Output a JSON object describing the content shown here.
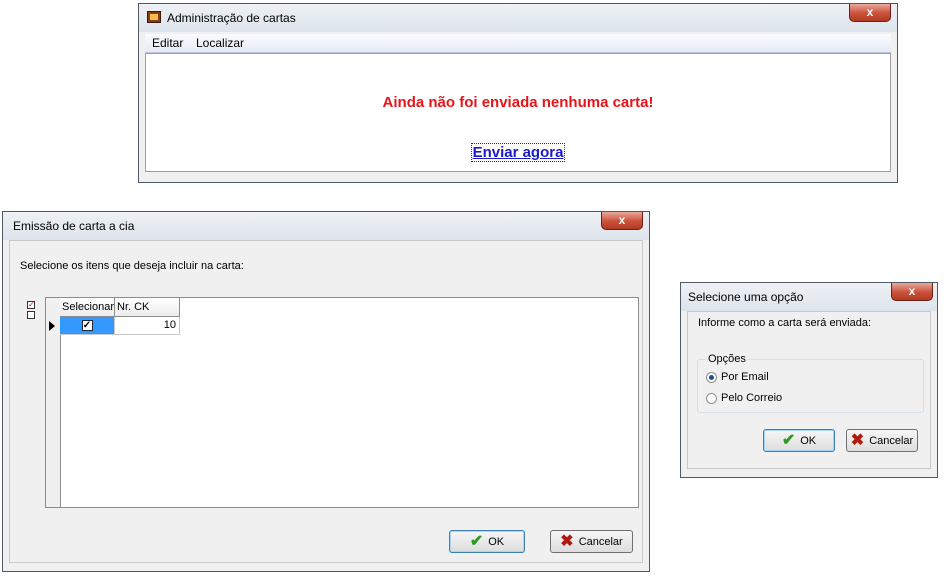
{
  "window_main": {
    "title": "Administração de cartas",
    "close_label": "x",
    "menu": [
      "Editar",
      "Localizar"
    ],
    "message": "Ainda não foi enviada nenhuma carta!",
    "link_label": "Enviar agora"
  },
  "window_emissao": {
    "title": "Emissão de carta a cia",
    "close_label": "x",
    "prompt": "Selecione os itens que deseja incluir na carta:",
    "grid": {
      "columns": [
        "Selecionar",
        "Nr. CK"
      ],
      "rows": [
        {
          "selected": true,
          "nr_ck": "10"
        }
      ]
    },
    "ok_label": "OK",
    "cancel_label": "Cancelar"
  },
  "window_opcao": {
    "title": "Selecione uma opção",
    "close_label": "x",
    "prompt": "Informe como a carta será enviada:",
    "group_label": "Opções",
    "options": [
      {
        "label": "Por Email",
        "selected": true
      },
      {
        "label": "Pelo Correio",
        "selected": false
      }
    ],
    "ok_label": "OK",
    "cancel_label": "Cancelar"
  }
}
